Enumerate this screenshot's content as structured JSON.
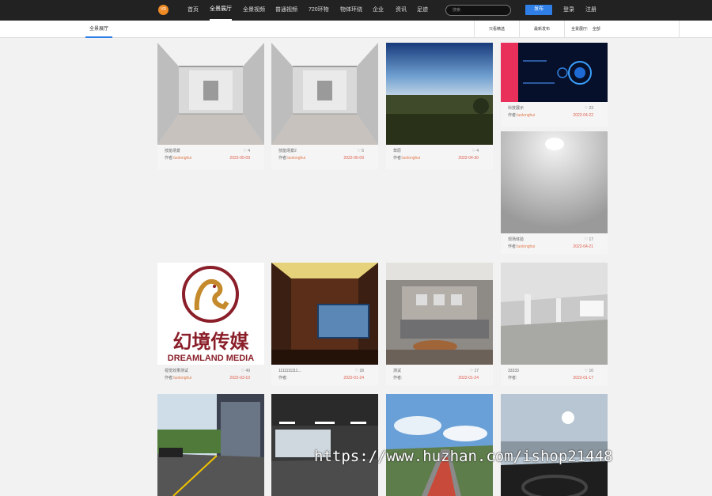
{
  "nav": {
    "logo": "VR",
    "items": [
      "首页",
      "全景展厅",
      "全景视频",
      "普通视频",
      "720环物",
      "物体环绕",
      "企业",
      "资讯",
      "足迹"
    ],
    "active": "全景展厅",
    "search_placeholder": "搜索",
    "publish": "发布",
    "login": "登录",
    "register": "注册"
  },
  "subbar": {
    "tab": "全景展厅",
    "filters": [
      "只看精选",
      "最新发布"
    ],
    "category_label": "全景展厅:",
    "category_value": "全部"
  },
  "cards": [
    {
      "title": "技能场景",
      "likes": "4",
      "author_label": "作者:",
      "author": "luolonghui",
      "date": "2022-05-09"
    },
    {
      "title": "技能场景2",
      "likes": "5",
      "author_label": "作者:",
      "author": "luolonghui",
      "date": "2022-05-09"
    },
    {
      "title": "草原",
      "likes": "4",
      "author_label": "作者:",
      "author": "luolonghui",
      "date": "2022-04-30"
    },
    {
      "title": "科技展示",
      "likes": "23",
      "author_label": "作者:",
      "author": "luolonghui",
      "date": "2022-04-22"
    },
    {
      "title": "现场体验",
      "likes": "17",
      "author_label": "作者:",
      "author": "luolonghui",
      "date": "2022-04-21"
    },
    {
      "title": "视觉效果测试",
      "likes": "49",
      "author_label": "作者:",
      "author": "luolonghui",
      "date": "2022-03-10"
    },
    {
      "title": "1111111111...",
      "likes": "28",
      "author_label": "作者:",
      "author": "",
      "date": "2022-01-24"
    },
    {
      "title": "测试",
      "likes": "17",
      "author_label": "作者:",
      "author": "",
      "date": "2022-01-24"
    },
    {
      "title": "33333",
      "likes": "10",
      "author_label": "作者:",
      "author": "",
      "date": "2022-01-17"
    }
  ],
  "logo_card": {
    "cn": "幻境传媒",
    "en": "DREAMLAND MEDIA"
  },
  "watermark": "https://www.huzhan.com/ishop21448"
}
